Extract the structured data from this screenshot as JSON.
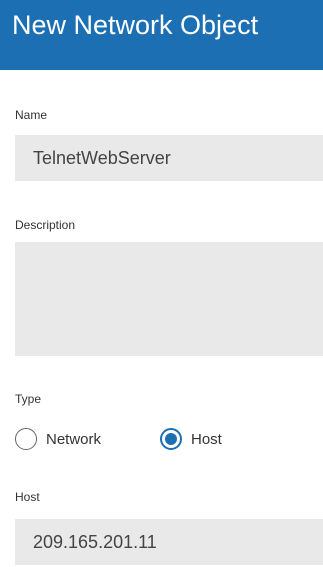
{
  "dialog": {
    "title": "New Network Object"
  },
  "form": {
    "name": {
      "label": "Name",
      "value": "TelnetWebServer"
    },
    "description": {
      "label": "Description",
      "value": ""
    },
    "type": {
      "label": "Type",
      "options": [
        {
          "label": "Network",
          "selected": false
        },
        {
          "label": "Host",
          "selected": true
        }
      ]
    },
    "host": {
      "label": "Host",
      "value": "209.165.201.11"
    }
  },
  "colors": {
    "accent": "#1d6fb3",
    "field_background": "#e9e9e9"
  }
}
